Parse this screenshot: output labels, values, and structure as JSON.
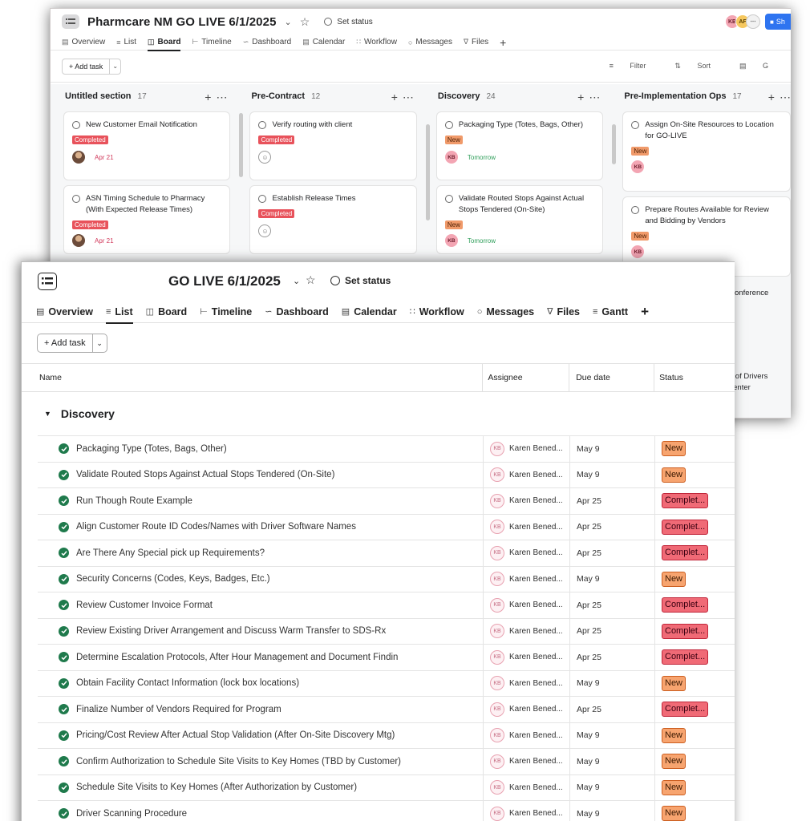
{
  "board_window": {
    "title": "Pharmcare NM GO LIVE 6/1/2025",
    "set_status": "Set status",
    "avatars": [
      "KB",
      "AF"
    ],
    "share_label": "Sh",
    "tabs": [
      "Overview",
      "List",
      "Board",
      "Timeline",
      "Dashboard",
      "Calendar",
      "Workflow",
      "Messages",
      "Files"
    ],
    "active_tab": "Board",
    "add_task": "+ Add task",
    "filter": "Filter",
    "sort": "Sort",
    "group_partial": "G",
    "columns": [
      {
        "name": "Untitled section",
        "count": "17",
        "cards": [
          {
            "title": "New Customer Email Notification",
            "tag": "Completed",
            "due": "Apr 21"
          },
          {
            "title": "ASN Timing Schedule to Pharmacy (With Expected Release Times)",
            "tag": "Completed",
            "due": "Apr 21"
          }
        ]
      },
      {
        "name": "Pre-Contract",
        "count": "12",
        "cards": [
          {
            "title": "Verify routing with client",
            "tag": "Completed",
            "due": ""
          },
          {
            "title": "Establish Release Times",
            "tag": "Completed",
            "due": ""
          }
        ]
      },
      {
        "name": "Discovery",
        "count": "24",
        "cards": [
          {
            "title": "Packaging Type (Totes, Bags, Other)",
            "tag": "New",
            "assignee": "KB",
            "due": "Tomorrow"
          },
          {
            "title": "Validate Routed Stops Against Actual Stops Tendered (On-Site)",
            "tag": "New",
            "assignee": "KB",
            "due": "Tomorrow"
          }
        ]
      },
      {
        "name": "Pre-Implementation Ops",
        "count": "17",
        "cards": [
          {
            "title": "Assign On-Site Resources to Location for GO-LIVE",
            "tag": "New",
            "assignee": "KB"
          },
          {
            "title": "Prepare Routes Available for Review and Bidding by Vendors",
            "tag": "New",
            "assignee": "KB"
          }
        ],
        "partial_texts": [
          "- Conference",
          "List of Drivers",
          "e Center"
        ]
      }
    ]
  },
  "list_window": {
    "title": "GO LIVE 6/1/2025",
    "set_status": "Set status",
    "tabs": [
      "Overview",
      "List",
      "Board",
      "Timeline",
      "Dashboard",
      "Calendar",
      "Workflow",
      "Messages",
      "Files",
      "Gantt"
    ],
    "active_tab": "List",
    "add_task": "+ Add task",
    "columns": {
      "name": "Name",
      "assignee": "Assignee",
      "due": "Due date",
      "status": "Status"
    },
    "section": "Discovery",
    "tasks": [
      {
        "name": "Packaging Type (Totes, Bags, Other)",
        "assignee_initials": "KB",
        "assignee": "Karen Bened...",
        "due": "May 9",
        "status": "New"
      },
      {
        "name": "Validate Routed Stops Against Actual Stops Tendered (On-Site)",
        "assignee_initials": "KB",
        "assignee": "Karen Bened...",
        "due": "May 9",
        "status": "New"
      },
      {
        "name": "Run Though Route Example",
        "assignee_initials": "KB",
        "assignee": "Karen Bened...",
        "due": "Apr 25",
        "status": "Complet..."
      },
      {
        "name": "Align Customer Route ID Codes/Names with Driver Software Names",
        "assignee_initials": "KB",
        "assignee": "Karen Bened...",
        "due": "Apr 25",
        "status": "Complet..."
      },
      {
        "name": "Are There Any Special pick up Requirements?",
        "assignee_initials": "KB",
        "assignee": "Karen Bened...",
        "due": "Apr 25",
        "status": "Complet..."
      },
      {
        "name": "Security Concerns (Codes, Keys, Badges, Etc.)",
        "assignee_initials": "KB",
        "assignee": "Karen Bened...",
        "due": "May 9",
        "status": "New"
      },
      {
        "name": "Review Customer Invoice Format",
        "assignee_initials": "KB",
        "assignee": "Karen Bened...",
        "due": "Apr 25",
        "status": "Complet..."
      },
      {
        "name": "Review Existing Driver Arrangement and Discuss Warm Transfer to SDS-Rx",
        "assignee_initials": "KB",
        "assignee": "Karen Bened...",
        "due": "Apr 25",
        "status": "Complet..."
      },
      {
        "name": "Determine Escalation Protocols, After Hour Management and Document Findin",
        "assignee_initials": "KB",
        "assignee": "Karen Bened...",
        "due": "Apr 25",
        "status": "Complet..."
      },
      {
        "name": "Obtain Facility Contact Information (lock box locations)",
        "assignee_initials": "KB",
        "assignee": "Karen Bened...",
        "due": "May 9",
        "status": "New"
      },
      {
        "name": "Finalize Number of Vendors Required for Program",
        "assignee_initials": "KB",
        "assignee": "Karen Bened...",
        "due": "Apr 25",
        "status": "Complet..."
      },
      {
        "name": "Pricing/Cost Review After Actual Stop Validation (After On-Site Discovery Mtg)",
        "assignee_initials": "KB",
        "assignee": "Karen Bened...",
        "due": "May 9",
        "status": "New"
      },
      {
        "name": "Confirm Authorization to Schedule Site Visits to Key Homes (TBD by Customer)",
        "assignee_initials": "KB",
        "assignee": "Karen Bened...",
        "due": "May 9",
        "status": "New"
      },
      {
        "name": "Schedule Site Visits to Key Homes (After Authorization by Customer)",
        "assignee_initials": "KB",
        "assignee": "Karen Bened...",
        "due": "May 9",
        "status": "New"
      },
      {
        "name": "Driver Scanning Procedure",
        "assignee_initials": "KB",
        "assignee": "Karen Bened...",
        "due": "May 9",
        "status": "New"
      }
    ]
  },
  "colors": {
    "completed": "#f06a76",
    "new": "#f7a46f",
    "check": "#1f7a4c",
    "share": "#2e74f0"
  }
}
